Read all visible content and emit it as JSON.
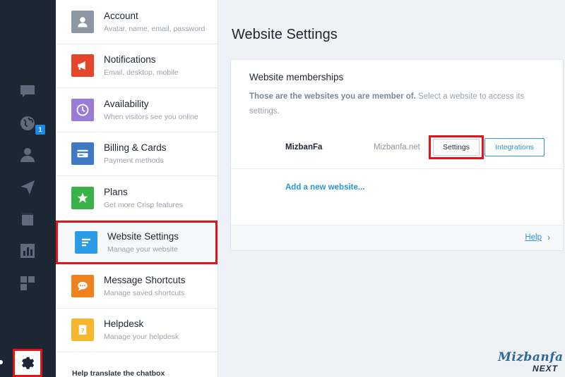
{
  "rail": {
    "icons": [
      "chat-icon",
      "globe-icon",
      "user-icon",
      "send-icon",
      "book-icon",
      "chart-icon",
      "plugins-icon",
      "gear-icon"
    ],
    "globe_badge": "1"
  },
  "menu": {
    "items": [
      {
        "title": "Account",
        "subtitle": "Avatar, name, email, password",
        "icon": "account-icon",
        "color": "#8d97a3"
      },
      {
        "title": "Notifications",
        "subtitle": "Email, desktop, mobile",
        "icon": "megaphone-icon",
        "color": "#e5452b"
      },
      {
        "title": "Availability",
        "subtitle": "When visitors see you online",
        "icon": "clock-icon",
        "color": "#9b7bd8"
      },
      {
        "title": "Billing & Cards",
        "subtitle": "Payment methods",
        "icon": "card-icon",
        "color": "#3f79c5"
      },
      {
        "title": "Plans",
        "subtitle": "Get more Crisp features",
        "icon": "star-icon",
        "color": "#37b34a"
      },
      {
        "title": "Website Settings",
        "subtitle": "Manage your website",
        "icon": "list-icon",
        "color": "#2b9be8"
      },
      {
        "title": "Message Shortcuts",
        "subtitle": "Manage saved shortcuts",
        "icon": "bubble-icon",
        "color": "#f0821e"
      },
      {
        "title": "Helpdesk",
        "subtitle": "Manage your helpdesk",
        "icon": "help-book-icon",
        "color": "#f4b72e"
      }
    ],
    "footer": "Help translate the chatbox"
  },
  "main": {
    "title": "Website Settings",
    "card": {
      "title": "Website memberships",
      "desc_bold": "Those are the websites you are member of.",
      "desc_rest": " Select a website to access its settings.",
      "site": {
        "name": "MizbanFa",
        "domain": "Mizbanfa.net"
      },
      "settings_label": "Settings",
      "integrations_label": "Integrations",
      "add_label": "Add a new website...",
      "help_label": "Help",
      "help_chevron": "›"
    }
  },
  "watermark": {
    "top": "Mizbanfa",
    "bottom": "NEXT"
  }
}
